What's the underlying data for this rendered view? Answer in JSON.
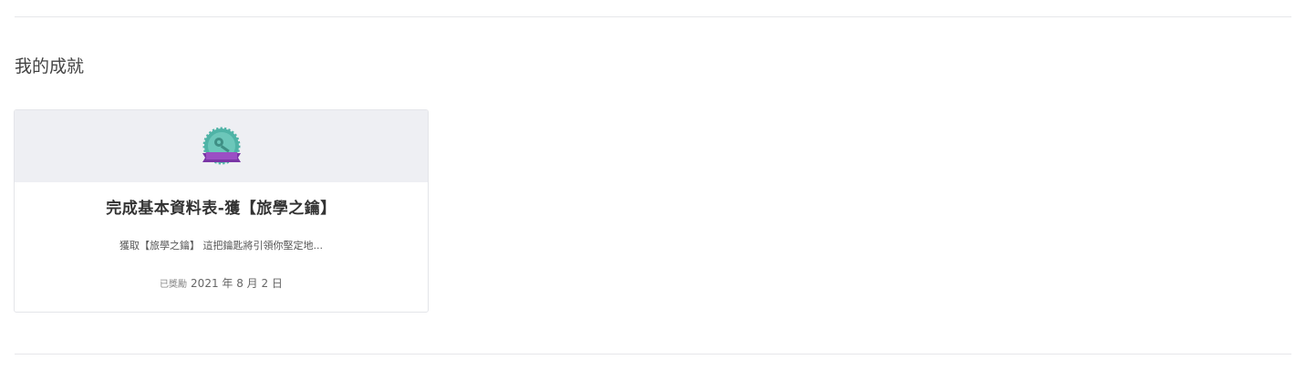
{
  "section": {
    "title": "我的成就"
  },
  "achievement": {
    "badge_icon": "key-badge-icon",
    "badge_colors": {
      "seal": "#4fb3a6",
      "ribbon": "#9b4fc4"
    },
    "title": "完成基本資料表-獲【旅學之鑰】",
    "description": "獲取【旅學之鑰】 這把鑰匙將引領你堅定地...",
    "awarded_label": "已獎勵",
    "awarded_date": "2021 年 8 月 2 日"
  }
}
